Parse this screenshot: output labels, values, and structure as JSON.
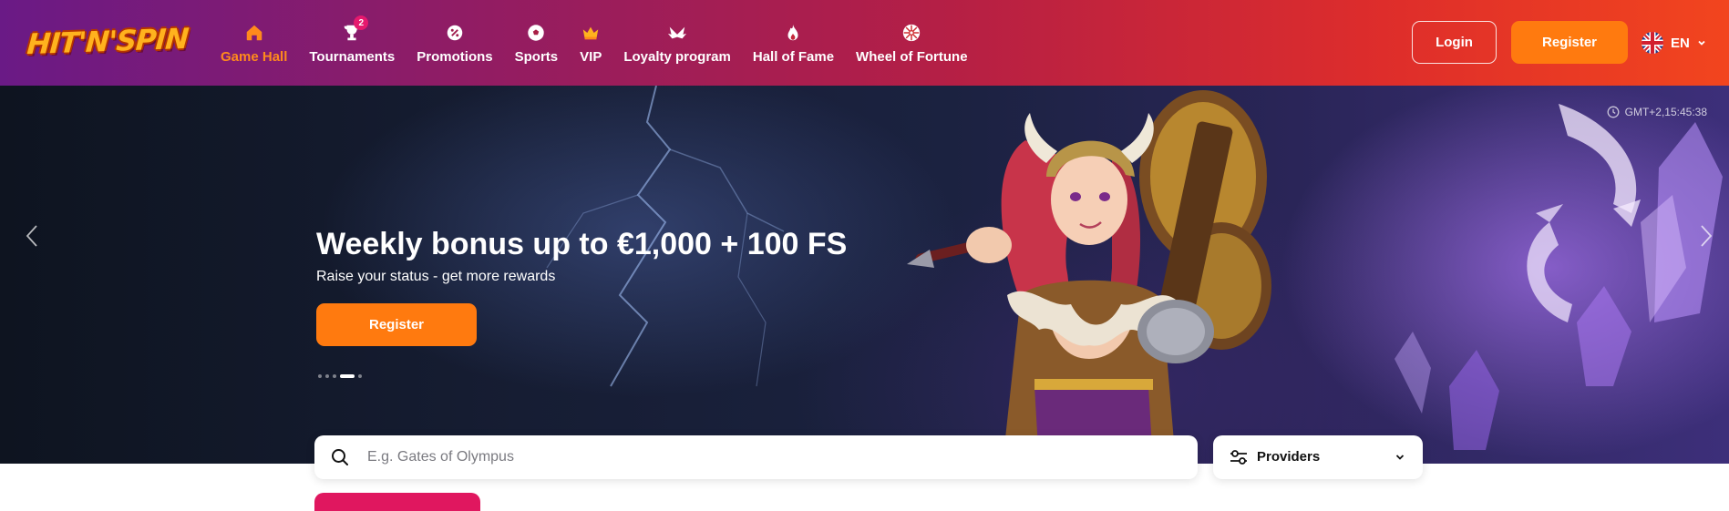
{
  "brand": {
    "logo_text": "HIT'N'SPIN",
    "accent": "#ff7a0f",
    "active_nav": "#ff8a1c"
  },
  "nav": {
    "items": [
      {
        "label": "Game Hall",
        "icon": "home-icon",
        "active": true
      },
      {
        "label": "Tournaments",
        "icon": "trophy-icon",
        "badge": "2"
      },
      {
        "label": "Promotions",
        "icon": "percent-badge-icon"
      },
      {
        "label": "Sports",
        "icon": "soccer-ball-icon"
      },
      {
        "label": "VIP",
        "icon": "crown-icon"
      },
      {
        "label": "Loyalty program",
        "icon": "wings-icon"
      },
      {
        "label": "Hall of Fame",
        "icon": "flame-icon"
      },
      {
        "label": "Wheel of Fortune",
        "icon": "wheel-icon"
      }
    ]
  },
  "auth": {
    "login_label": "Login",
    "register_label": "Register"
  },
  "language": {
    "code": "EN",
    "flag": "uk-flag-icon"
  },
  "hero": {
    "clock_text": "GMT+2,15:45:38",
    "title": "Weekly bonus up to €1,000 + 100 FS",
    "subtitle": "Raise your status - get more rewards",
    "cta_label": "Register",
    "slide_count": 5,
    "active_slide": 4
  },
  "search": {
    "placeholder": "E.g. Gates of Olympus",
    "value": ""
  },
  "providers": {
    "label": "Providers"
  }
}
